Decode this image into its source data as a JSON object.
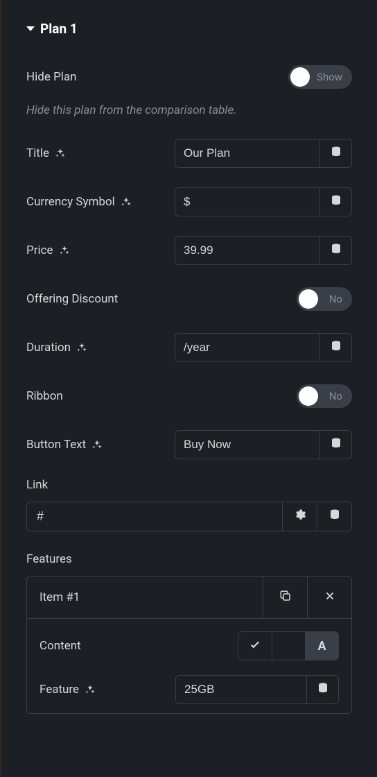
{
  "section": {
    "title": "Plan 1"
  },
  "hidePlan": {
    "label": "Hide Plan",
    "toggleLabel": "Show",
    "description": "Hide this plan from the comparison table."
  },
  "title": {
    "label": "Title",
    "value": "Our Plan"
  },
  "currencySymbol": {
    "label": "Currency Symbol",
    "value": "$"
  },
  "price": {
    "label": "Price",
    "value": "39.99"
  },
  "offeringDiscount": {
    "label": "Offering Discount",
    "toggleLabel": "No"
  },
  "duration": {
    "label": "Duration",
    "value": "/year"
  },
  "ribbon": {
    "label": "Ribbon",
    "toggleLabel": "No"
  },
  "buttonText": {
    "label": "Button Text",
    "value": "Buy Now"
  },
  "link": {
    "label": "Link",
    "value": "#"
  },
  "features": {
    "label": "Features",
    "items": [
      {
        "name": "Item #1",
        "content": {
          "label": "Content"
        },
        "feature": {
          "label": "Feature",
          "value": "25GB"
        }
      }
    ]
  }
}
